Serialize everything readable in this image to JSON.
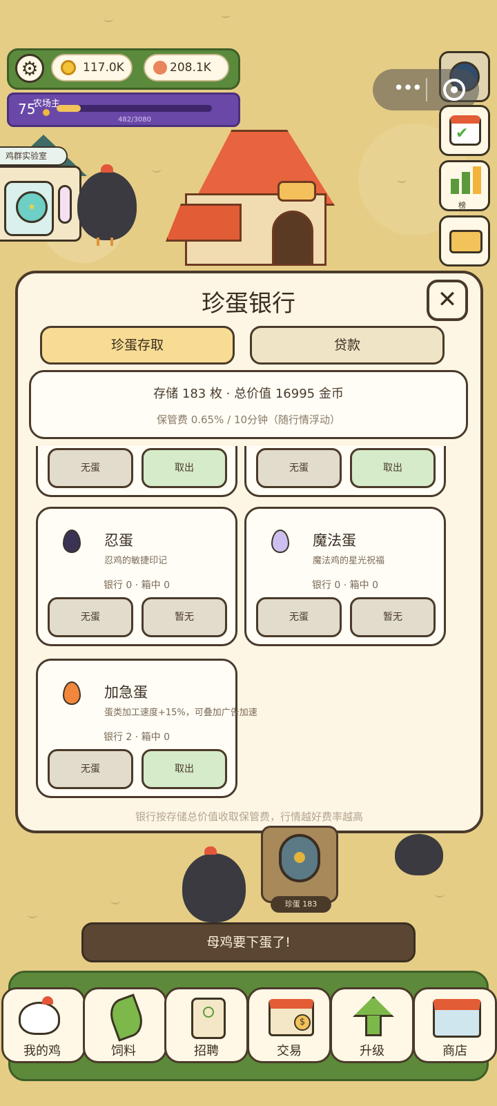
{
  "hud": {
    "gold": "117.0K",
    "copper": "208.1K",
    "level": "75",
    "level_title": "农场主",
    "xp_text": "482/3080",
    "xp_fraction": 0.156
  },
  "side_buttons": {
    "ranking_label": "榜"
  },
  "lab": {
    "sign": "鸡群实验室"
  },
  "modal": {
    "title": "珍蛋银行",
    "close_symbol": "✕",
    "tabs": [
      {
        "label": "珍蛋存取",
        "active": true
      },
      {
        "label": "贷款",
        "active": false
      }
    ],
    "summary_main": "存储 183 枚 · 总价值 16995 金币",
    "summary_sub": "保管费 0.65% / 10分钟（随行情浮动）",
    "partial_cards": [
      {
        "left_button": "无蛋",
        "right_button": "取出"
      },
      {
        "left_button": "无蛋",
        "right_button": "取出"
      }
    ],
    "cards": [
      {
        "name": "忍蛋",
        "desc": "忍鸡的敏捷印记",
        "stock": "银行 0 · 箱中 0",
        "left_button": "无蛋",
        "right_button": "暂无",
        "egg_color": "#3a3356",
        "right_enabled": false
      },
      {
        "name": "魔法蛋",
        "desc": "魔法鸡的星光祝福",
        "stock": "银行 0 · 箱中 0",
        "left_button": "无蛋",
        "right_button": "暂无",
        "egg_color": "#cdbff0",
        "right_enabled": false
      },
      {
        "name": "加急蛋",
        "desc": "蛋类加工速度+15%，可叠加广告加速",
        "stock": "银行 2 · 箱中 0",
        "left_button": "无蛋",
        "right_button": "取出",
        "egg_color": "#f2863c",
        "right_enabled": true
      }
    ],
    "footer": "银行按存储总价值收取保管费，行情越好费率越高"
  },
  "vault": {
    "label": "珍蛋 183"
  },
  "toast": "母鸡要下蛋了!",
  "nav": [
    {
      "label": "我的鸡",
      "icon": "chicken-icon"
    },
    {
      "label": "饲料",
      "icon": "leaf-icon"
    },
    {
      "label": "招聘",
      "icon": "badge-icon"
    },
    {
      "label": "交易",
      "icon": "market-icon"
    },
    {
      "label": "升级",
      "icon": "upgrade-arrow-icon"
    },
    {
      "label": "商店",
      "icon": "shop-icon"
    }
  ]
}
